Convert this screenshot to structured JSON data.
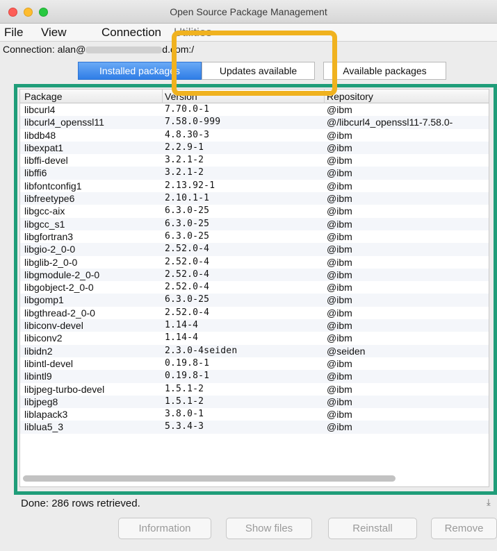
{
  "window": {
    "title": "Open Source Package Management"
  },
  "menu": {
    "items": [
      "File",
      "View",
      "Connection",
      "Utilities"
    ]
  },
  "connection": {
    "label": "Connection: alan@",
    "host_suffix": "d.com:/"
  },
  "tabs": [
    {
      "label": "Installed packages",
      "active": true
    },
    {
      "label": "Updates available",
      "active": false
    },
    {
      "label": "Available packages",
      "active": false
    }
  ],
  "table": {
    "columns": [
      "Package",
      "Version",
      "Repository"
    ],
    "rows": [
      [
        "libcurl4",
        "7.70.0-1",
        "@ibm"
      ],
      [
        "libcurl4_openssl11",
        "7.58.0-999",
        "@/libcurl4_openssl11-7.58.0-"
      ],
      [
        "libdb48",
        "4.8.30-3",
        "@ibm"
      ],
      [
        "libexpat1",
        "2.2.9-1",
        "@ibm"
      ],
      [
        "libffi-devel",
        "3.2.1-2",
        "@ibm"
      ],
      [
        "libffi6",
        "3.2.1-2",
        "@ibm"
      ],
      [
        "libfontconfig1",
        "2.13.92-1",
        "@ibm"
      ],
      [
        "libfreetype6",
        "2.10.1-1",
        "@ibm"
      ],
      [
        "libgcc-aix",
        "6.3.0-25",
        "@ibm"
      ],
      [
        "libgcc_s1",
        "6.3.0-25",
        "@ibm"
      ],
      [
        "libgfortran3",
        "6.3.0-25",
        "@ibm"
      ],
      [
        "libgio-2_0-0",
        "2.52.0-4",
        "@ibm"
      ],
      [
        "libglib-2_0-0",
        "2.52.0-4",
        "@ibm"
      ],
      [
        "libgmodule-2_0-0",
        "2.52.0-4",
        "@ibm"
      ],
      [
        "libgobject-2_0-0",
        "2.52.0-4",
        "@ibm"
      ],
      [
        "libgomp1",
        "6.3.0-25",
        "@ibm"
      ],
      [
        "libgthread-2_0-0",
        "2.52.0-4",
        "@ibm"
      ],
      [
        "libiconv-devel",
        "1.14-4",
        "@ibm"
      ],
      [
        "libiconv2",
        "1.14-4",
        "@ibm"
      ],
      [
        "libidn2",
        "2.3.0-4seiden",
        "@seiden"
      ],
      [
        "libintl-devel",
        "0.19.8-1",
        "@ibm"
      ],
      [
        "libintl9",
        "0.19.8-1",
        "@ibm"
      ],
      [
        "libjpeg-turbo-devel",
        "1.5.1-2",
        "@ibm"
      ],
      [
        "libjpeg8",
        "1.5.1-2",
        "@ibm"
      ],
      [
        "liblapack3",
        "3.8.0-1",
        "@ibm"
      ],
      [
        "liblua5_3",
        "5.3.4-3",
        "@ibm"
      ]
    ]
  },
  "status": {
    "text": "Done: 286 rows retrieved."
  },
  "buttons": {
    "information": "Information",
    "show_files": "Show files",
    "reinstall": "Reinstall",
    "remove": "Remove"
  },
  "colors": {
    "highlight_orange": "#f0b21f",
    "highlight_green": "#1f9d79",
    "tab_active": "#2f7de6"
  }
}
